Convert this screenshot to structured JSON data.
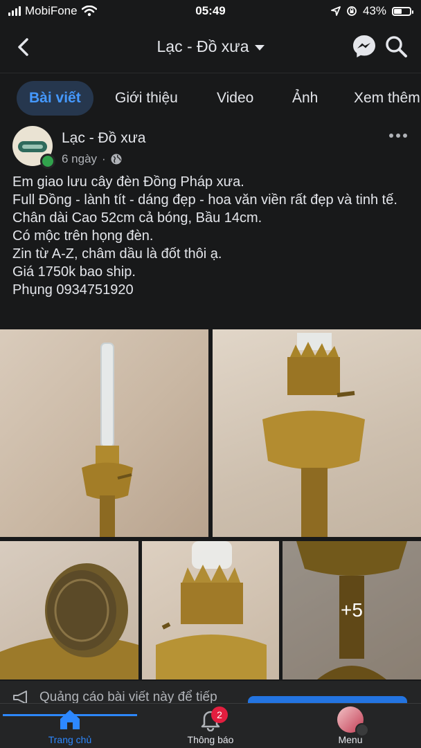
{
  "status_bar": {
    "carrier": "MobiFone",
    "time": "05:49",
    "battery": "43%"
  },
  "header": {
    "title": "Lạc - Đồ xưa"
  },
  "tabs": [
    {
      "label": "Bài viết",
      "active": true
    },
    {
      "label": "Giới thiệu"
    },
    {
      "label": "Video"
    },
    {
      "label": "Ảnh"
    },
    {
      "label": "Xem thêm"
    }
  ],
  "post": {
    "author": "Lạc - Đồ xưa",
    "time": "6 ngày",
    "lines": [
      "Em giao lưu cây đèn Đồng Pháp xưa.",
      "Full Đồng - lành tít - dáng đẹp - hoa văn viền rất đẹp và tinh tế.",
      "Chân dài Cao 52cm cả bóng, Bầu 14cm.",
      "Có mộc trên họng đèn.",
      "Zin từ A-Z, châm dầu là đốt thôi ạ.",
      "Giá 1750k bao ship.",
      "Phụng 0934751920"
    ],
    "more_photos": "+5"
  },
  "ad": {
    "text": "Quảng cáo bài viết này để tiếp"
  },
  "bottom_nav": [
    {
      "label": "Trang chủ",
      "active": true
    },
    {
      "label": "Thông báo",
      "badge": "2"
    },
    {
      "label": "Menu"
    }
  ],
  "colors": {
    "accent": "#2d88ff",
    "badge": "#e41e3f",
    "background": "#18191a"
  }
}
